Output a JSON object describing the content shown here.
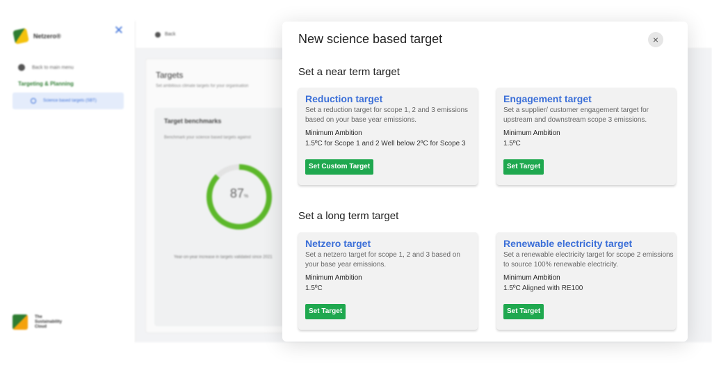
{
  "sidebar": {
    "brand": "Netzero®",
    "back_label": "Back to main menu",
    "section_label": "Targeting & Planning",
    "active_item": "Science based targets (SBT)",
    "bottom_brand": "The Sustainability Cloud"
  },
  "topbar": {
    "back_label": "Back"
  },
  "background": {
    "targets_title": "Targets",
    "targets_subtitle": "Set ambitious climate targets for your organisation",
    "benchmarks_title": "Target benchmarks",
    "benchmarks_subtitle": "Benchmark your science based targets against",
    "gauge": {
      "value": 87,
      "value_label": "87",
      "unit": "%"
    },
    "benchmarks_footnote": "Year-on-year increase in targets validated since 2021"
  },
  "modal": {
    "title": "New science based target",
    "close_glyph": "×",
    "near_term_heading": "Set a near term target",
    "long_term_heading": "Set a long term target",
    "ambition_label": "Minimum Ambition",
    "cards": {
      "reduction": {
        "title": "Reduction target",
        "description": "Set a reduction target for scope 1, 2 and 3 emissions based on your base year emissions.",
        "ambition": "1.5ºC for Scope 1 and 2 Well below 2ºC for Scope 3",
        "button": "Set Custom Target"
      },
      "engagement": {
        "title": "Engagement target",
        "description": "Set a supplier/ customer engagement target for upstream and downstream scope 3 emissions.",
        "ambition": "1.5ºC",
        "button": "Set Target"
      },
      "netzero": {
        "title": "Netzero target",
        "description": "Set a netzero target for scope 1, 2 and 3 based on your base year emissions.",
        "ambition": "1.5ºC",
        "button": "Set Target"
      },
      "renewable": {
        "title": "Renewable electricity target",
        "description": "Set a renewable electricity target for scope 2 emissions to source 100% renewable electricity.",
        "ambition": "1.5ºC Aligned with RE100",
        "button": "Set Target"
      }
    }
  },
  "colors": {
    "accent_blue": "#3b6fd8",
    "button_green": "#1fa84f",
    "gauge_green": "#5cb82a"
  },
  "icons": [
    "close-icon",
    "back-icon",
    "logo-icon",
    "nav-dot-icon"
  ]
}
